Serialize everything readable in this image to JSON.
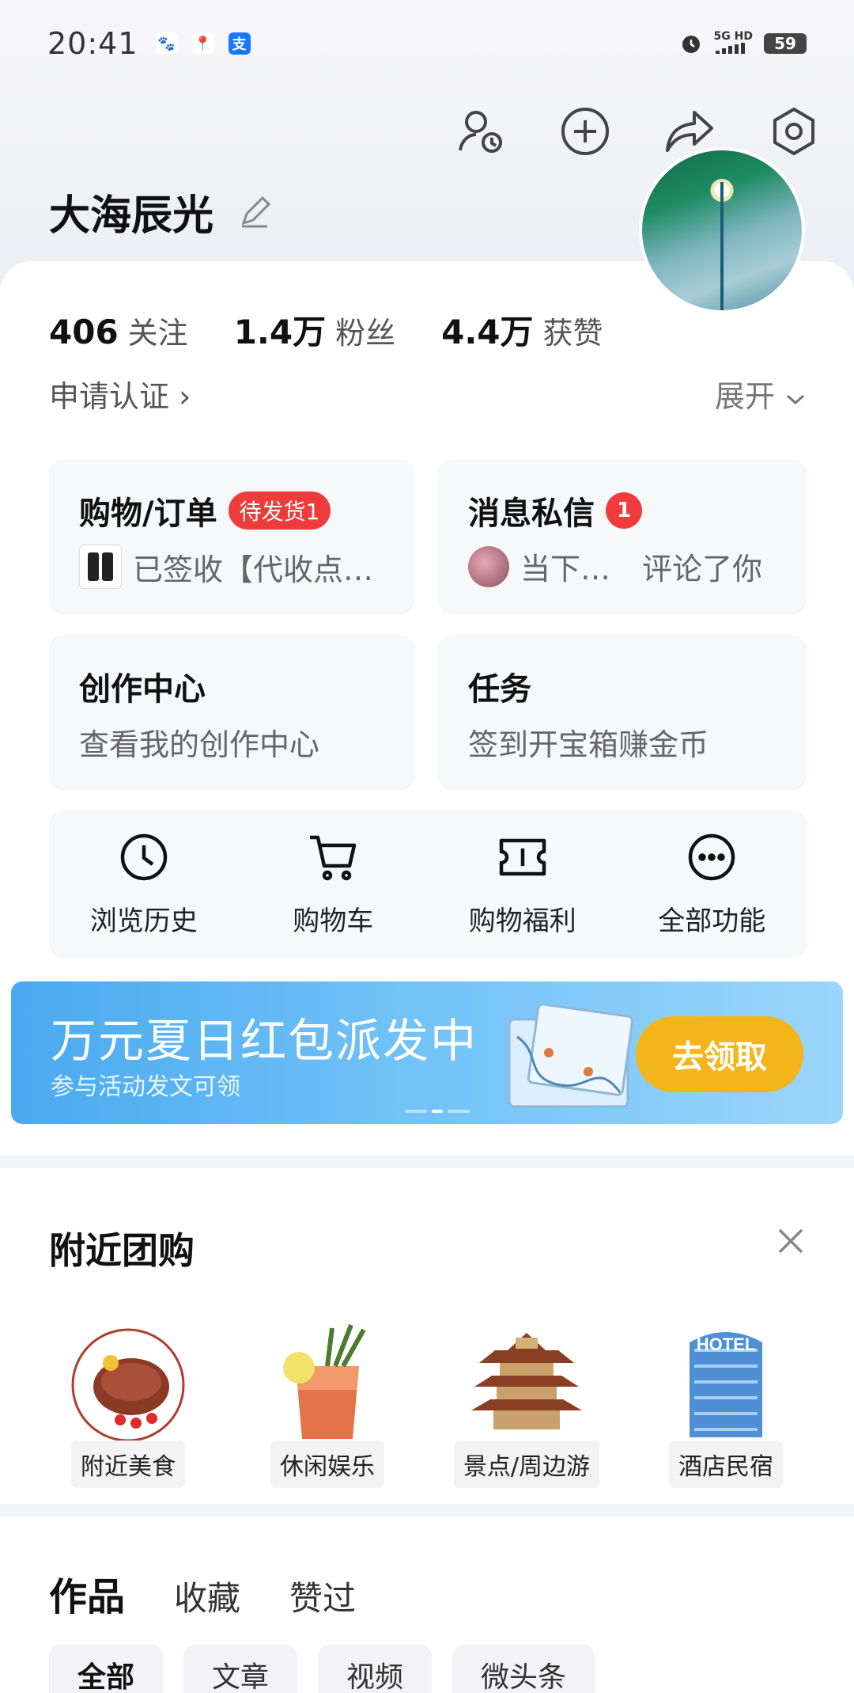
{
  "status": {
    "time": "20:41",
    "network_top": "5G HD",
    "battery": "59"
  },
  "profile": {
    "name": "大海辰光",
    "stats": [
      {
        "num": "406",
        "label": "关注"
      },
      {
        "num": "1.4万",
        "label": "粉丝"
      },
      {
        "num": "4.4万",
        "label": "获赞"
      }
    ],
    "verify_label": "申请认证 ›",
    "expand_label": "展开"
  },
  "tiles": {
    "orders": {
      "title": "购物/订单",
      "badge": "待发货1",
      "sub": "已签收【代收点…"
    },
    "messages": {
      "title": "消息私信",
      "badge": "1",
      "sub_name": "当下…",
      "sub_action": "评论了你"
    },
    "creator": {
      "title": "创作中心",
      "sub": "查看我的创作中心"
    },
    "tasks": {
      "title": "任务",
      "sub": "签到开宝箱赚金币"
    }
  },
  "quick": [
    {
      "label": "浏览历史",
      "icon": "clock-icon"
    },
    {
      "label": "购物车",
      "icon": "cart-icon"
    },
    {
      "label": "购物福利",
      "icon": "ticket-icon"
    },
    {
      "label": "全部功能",
      "icon": "more-icon"
    }
  ],
  "banner": {
    "title": "万元夏日红包派发中",
    "sub": "参与活动发文可领",
    "button": "去领取"
  },
  "nearby": {
    "title": "附近团购",
    "items": [
      {
        "label": "附近美食"
      },
      {
        "label": "休闲娱乐"
      },
      {
        "label": "景点/周边游"
      },
      {
        "label": "酒店民宿"
      }
    ]
  },
  "works": {
    "tabs": [
      "作品",
      "收藏",
      "赞过"
    ],
    "chips": [
      "全部",
      "文章",
      "视频",
      "微头条"
    ]
  },
  "colors": {
    "accent_red": "#ef3b3b",
    "banner_button": "#f2b61a",
    "banner_blue": "#4aa9ef"
  }
}
